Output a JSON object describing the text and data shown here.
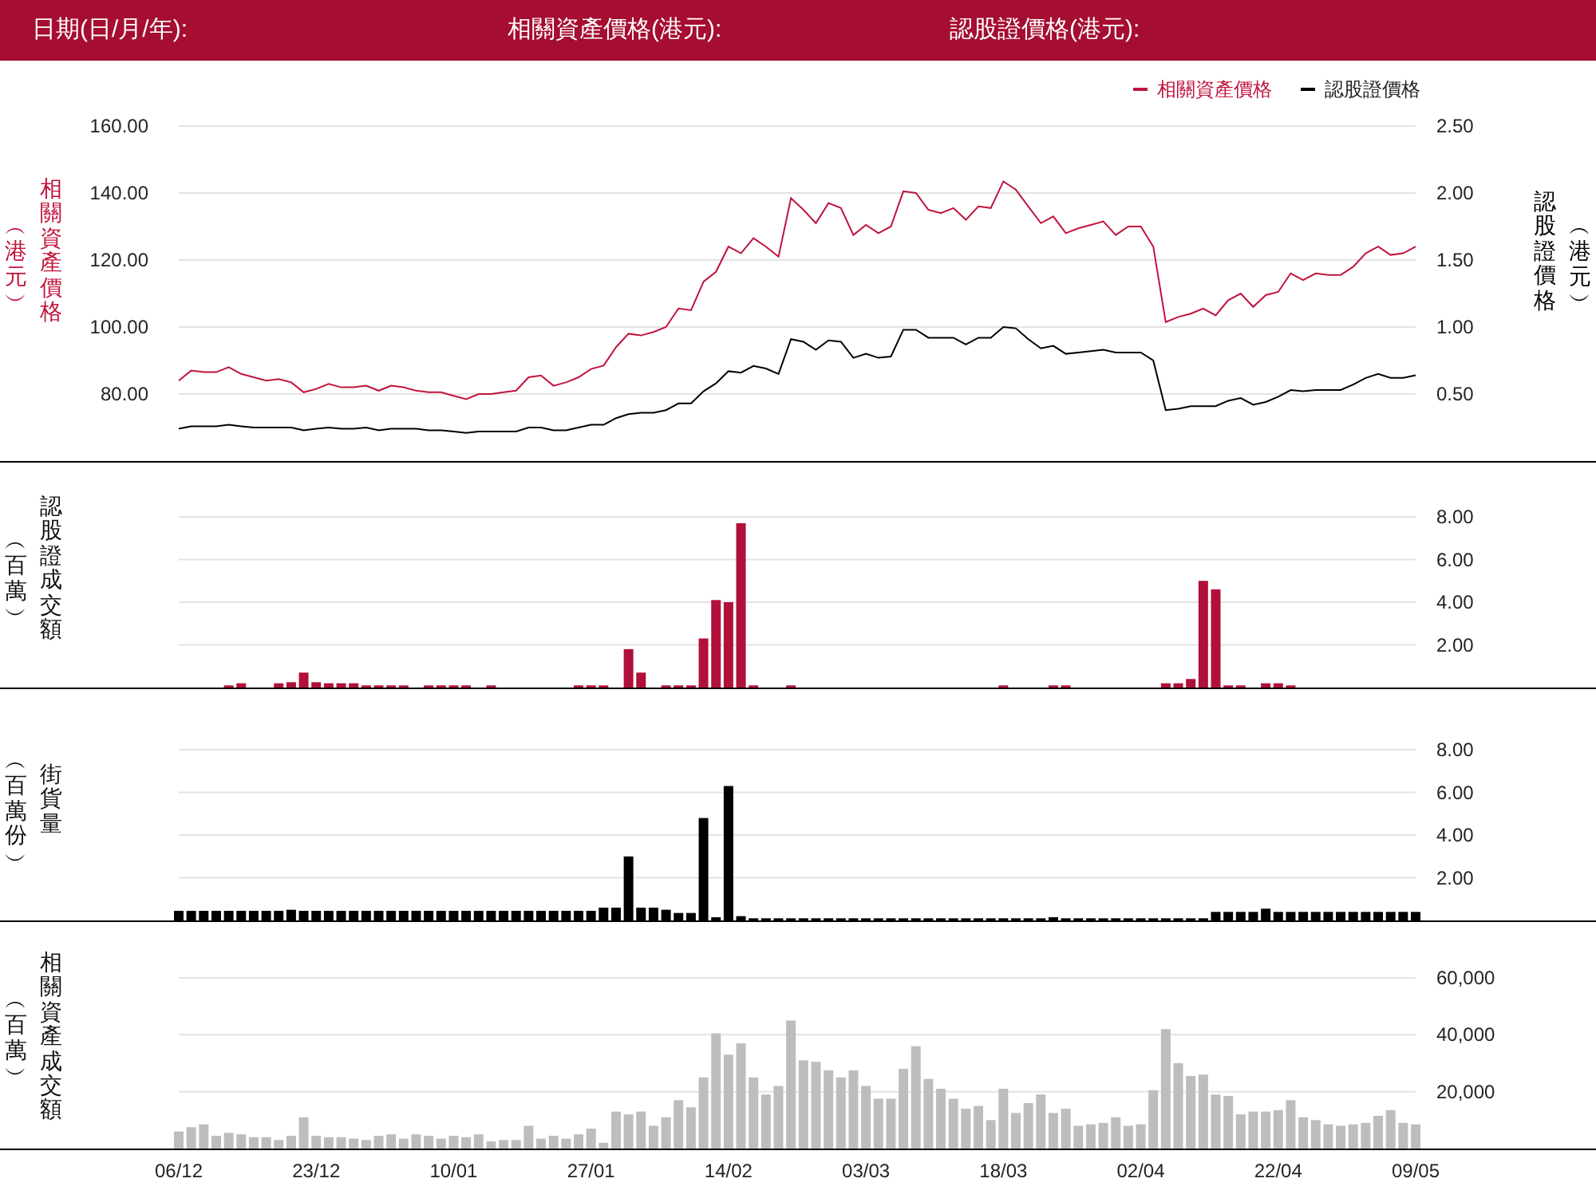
{
  "header": {
    "fields": [
      {
        "label": "日期(日/月/年):"
      },
      {
        "label": "相關資產價格(港元):"
      },
      {
        "label": "認股證價格(港元):"
      }
    ]
  },
  "price_panel": {
    "left_axis_label": "相關資產價格",
    "left_axis_unit": "︵港元︶",
    "right_axis_label": "認股證價格",
    "right_axis_unit": "︵港元︶",
    "chart_data": {
      "type": "line",
      "grid": true,
      "legend": true,
      "ylim": [
        60,
        160
      ],
      "y2lim": [
        0,
        2.5
      ],
      "yticks": [
        {
          "value": 80,
          "label": "80.00"
        },
        {
          "value": 100,
          "label": "100.00"
        },
        {
          "value": 120,
          "label": "120.00"
        },
        {
          "value": 140,
          "label": "140.00"
        },
        {
          "value": 160,
          "label": "160.00"
        }
      ],
      "y2ticks": [
        {
          "value": 0.5,
          "label": "0.50"
        },
        {
          "value": 1,
          "label": "1.00"
        },
        {
          "value": 1.5,
          "label": "1.50"
        },
        {
          "value": 2,
          "label": "2.00"
        },
        {
          "value": 2.5,
          "label": "2.50"
        }
      ],
      "series": [
        {
          "name": "相關資產價格",
          "color": "#c0143c",
          "values": [
            84,
            87,
            86.5,
            86.5,
            88,
            86,
            85,
            84,
            84.5,
            83.5,
            80.5,
            81.5,
            83,
            82,
            82,
            82.5,
            81,
            82.5,
            82,
            81,
            80.5,
            80.5,
            79.5,
            78.5,
            80,
            80,
            80.5,
            81,
            85,
            85.5,
            82.5,
            83.5,
            85,
            87.5,
            88.5,
            94,
            98,
            97.5,
            98.5,
            100,
            105.5,
            105,
            113.5,
            116.5,
            124,
            122,
            126.5,
            124,
            121,
            138.5,
            135,
            131,
            137,
            135.5,
            127.5,
            130.5,
            128,
            130,
            140.5,
            140,
            135,
            134,
            135.5,
            132,
            136,
            135.5,
            143.5,
            141,
            136,
            131,
            133,
            128,
            129.5,
            130.5,
            131.5,
            127.5,
            130,
            130,
            124,
            101.5,
            103,
            104,
            105.5,
            103.5,
            108,
            110,
            106,
            109.5,
            110.5,
            116,
            114,
            116,
            115.5,
            115.5,
            118,
            122,
            124,
            121.5,
            122,
            124
          ]
        },
        {
          "name": "認股證價格",
          "color": "#000000",
          "axis": "y2",
          "values": [
            0.24,
            0.26,
            0.26,
            0.26,
            0.27,
            0.26,
            0.25,
            0.25,
            0.25,
            0.25,
            0.23,
            0.24,
            0.25,
            0.24,
            0.24,
            0.25,
            0.23,
            0.24,
            0.24,
            0.24,
            0.23,
            0.23,
            0.22,
            0.21,
            0.22,
            0.22,
            0.22,
            0.22,
            0.25,
            0.25,
            0.23,
            0.23,
            0.25,
            0.27,
            0.27,
            0.32,
            0.35,
            0.36,
            0.36,
            0.38,
            0.43,
            0.43,
            0.52,
            0.58,
            0.67,
            0.66,
            0.71,
            0.69,
            0.65,
            0.91,
            0.89,
            0.83,
            0.9,
            0.89,
            0.77,
            0.8,
            0.77,
            0.78,
            0.98,
            0.98,
            0.92,
            0.92,
            0.92,
            0.87,
            0.92,
            0.92,
            1,
            0.99,
            0.91,
            0.84,
            0.86,
            0.8,
            0.81,
            0.82,
            0.83,
            0.81,
            0.81,
            0.81,
            0.75,
            0.38,
            0.39,
            0.41,
            0.41,
            0.41,
            0.45,
            0.47,
            0.42,
            0.44,
            0.48,
            0.53,
            0.52,
            0.53,
            0.53,
            0.53,
            0.57,
            0.62,
            0.65,
            0.62,
            0.62,
            0.64
          ]
        }
      ]
    }
  },
  "warrant_turnover_panel": {
    "axis_label": "認股證成交額",
    "axis_unit": "︵百萬︶",
    "chart_data": {
      "type": "bar",
      "grid": true,
      "ylim": [
        0,
        8
      ],
      "yticks": [
        {
          "value": 2,
          "label": "2.00"
        },
        {
          "value": 4,
          "label": "4.00"
        },
        {
          "value": 6,
          "label": "6.00"
        },
        {
          "value": 8,
          "label": "8.00"
        }
      ],
      "series": [
        {
          "color": "#b0103a",
          "values": [
            0,
            0,
            0,
            0,
            0.1,
            0.2,
            0,
            0,
            0.2,
            0.25,
            0.7,
            0.25,
            0.2,
            0.2,
            0.2,
            0.1,
            0.1,
            0.1,
            0.1,
            0,
            0.1,
            0.1,
            0.1,
            0.1,
            0,
            0.1,
            0,
            0,
            0,
            0,
            0,
            0,
            0.1,
            0.1,
            0.1,
            0,
            1.8,
            0.7,
            0,
            0.1,
            0.1,
            0.1,
            2.3,
            4.1,
            4,
            7.7,
            0.1,
            0,
            0,
            0.1,
            0,
            0,
            0,
            0,
            0,
            0,
            0,
            0,
            0,
            0,
            0,
            0,
            0,
            0,
            0,
            0,
            0.1,
            0,
            0,
            0,
            0.1,
            0.1,
            0,
            0,
            0,
            0,
            0,
            0,
            0,
            0.2,
            0.2,
            0.4,
            5,
            4.6,
            0.1,
            0.1,
            0,
            0.2,
            0.2,
            0.1,
            0,
            0,
            0,
            0,
            0,
            0,
            0,
            0,
            0,
            0
          ]
        }
      ]
    }
  },
  "outstanding_panel": {
    "axis_label": "街貨量",
    "axis_unit": "︵百萬份︶",
    "chart_data": {
      "type": "bar",
      "grid": true,
      "ylim": [
        0,
        8
      ],
      "yticks": [
        {
          "value": 2,
          "label": "2.00"
        },
        {
          "value": 4,
          "label": "4.00"
        },
        {
          "value": 6,
          "label": "6.00"
        },
        {
          "value": 8,
          "label": "8.00"
        }
      ],
      "series": [
        {
          "color": "#000000",
          "values": [
            0.45,
            0.45,
            0.45,
            0.45,
            0.45,
            0.45,
            0.45,
            0.45,
            0.45,
            0.5,
            0.45,
            0.45,
            0.45,
            0.45,
            0.45,
            0.45,
            0.45,
            0.45,
            0.45,
            0.45,
            0.45,
            0.45,
            0.45,
            0.45,
            0.45,
            0.45,
            0.45,
            0.45,
            0.45,
            0.45,
            0.45,
            0.45,
            0.45,
            0.45,
            0.6,
            0.6,
            3,
            0.6,
            0.6,
            0.5,
            0.35,
            0.35,
            4.8,
            0.15,
            6.3,
            0.2,
            0.1,
            0.1,
            0.1,
            0.1,
            0.1,
            0.1,
            0.1,
            0.1,
            0.1,
            0.1,
            0.1,
            0.1,
            0.1,
            0.1,
            0.1,
            0.1,
            0.1,
            0.1,
            0.1,
            0.1,
            0.1,
            0.1,
            0.1,
            0.1,
            0.15,
            0.1,
            0.1,
            0.1,
            0.1,
            0.1,
            0.1,
            0.1,
            0.1,
            0.1,
            0.1,
            0.1,
            0.1,
            0.4,
            0.4,
            0.4,
            0.4,
            0.55,
            0.4,
            0.4,
            0.4,
            0.4,
            0.4,
            0.4,
            0.4,
            0.4,
            0.4,
            0.4,
            0.4,
            0.4
          ]
        }
      ]
    }
  },
  "asset_turnover_panel": {
    "axis_label": "相關資產成交額",
    "axis_unit": "︵百萬︶",
    "chart_data": {
      "type": "bar",
      "grid": true,
      "ylim": [
        0,
        60000
      ],
      "yticks": [
        {
          "value": 20000,
          "label": "20,000"
        },
        {
          "value": 40000,
          "label": "40,000"
        },
        {
          "value": 60000,
          "label": "60,000"
        }
      ],
      "categories": [
        "06/12",
        null,
        null,
        null,
        null,
        null,
        null,
        null,
        null,
        null,
        null,
        "23/12",
        null,
        null,
        null,
        null,
        null,
        null,
        null,
        null,
        null,
        null,
        "10/01",
        null,
        null,
        null,
        null,
        null,
        null,
        null,
        null,
        null,
        null,
        "27/01",
        null,
        null,
        null,
        null,
        null,
        null,
        null,
        null,
        null,
        null,
        "14/02",
        null,
        null,
        null,
        null,
        null,
        null,
        null,
        null,
        null,
        null,
        "03/03",
        null,
        null,
        null,
        null,
        null,
        null,
        null,
        null,
        null,
        null,
        "18/03",
        null,
        null,
        null,
        null,
        null,
        null,
        null,
        null,
        null,
        null,
        "02/04",
        null,
        null,
        null,
        null,
        null,
        null,
        null,
        null,
        null,
        null,
        "22/04",
        null,
        null,
        null,
        null,
        null,
        null,
        null,
        null,
        null,
        null,
        "09/05"
      ],
      "series": [
        {
          "color": "#bdbdbd",
          "values": [
            6000,
            7500,
            8500,
            4500,
            5500,
            5000,
            4000,
            4000,
            3000,
            4500,
            11000,
            4500,
            4000,
            4000,
            3500,
            3000,
            4500,
            5000,
            3500,
            5000,
            4500,
            3500,
            4500,
            4000,
            5000,
            2500,
            3000,
            3000,
            8000,
            3500,
            4500,
            3500,
            5000,
            7000,
            2000,
            13000,
            12000,
            13000,
            8000,
            11000,
            17000,
            14500,
            25000,
            40500,
            33000,
            37000,
            25000,
            19000,
            22000,
            45000,
            31000,
            30500,
            27500,
            25000,
            27500,
            22000,
            17500,
            17500,
            28000,
            36000,
            24500,
            21000,
            17500,
            14000,
            15000,
            10000,
            21000,
            12500,
            16000,
            19000,
            12500,
            14000,
            8000,
            8500,
            9000,
            11000,
            8000,
            8500,
            20500,
            42000,
            30000,
            25500,
            26000,
            19000,
            18500,
            12000,
            13000,
            13000,
            13500,
            17000,
            11000,
            10000,
            8500,
            8000,
            8500,
            9000,
            11500,
            13500,
            9000,
            8500
          ]
        }
      ]
    }
  }
}
